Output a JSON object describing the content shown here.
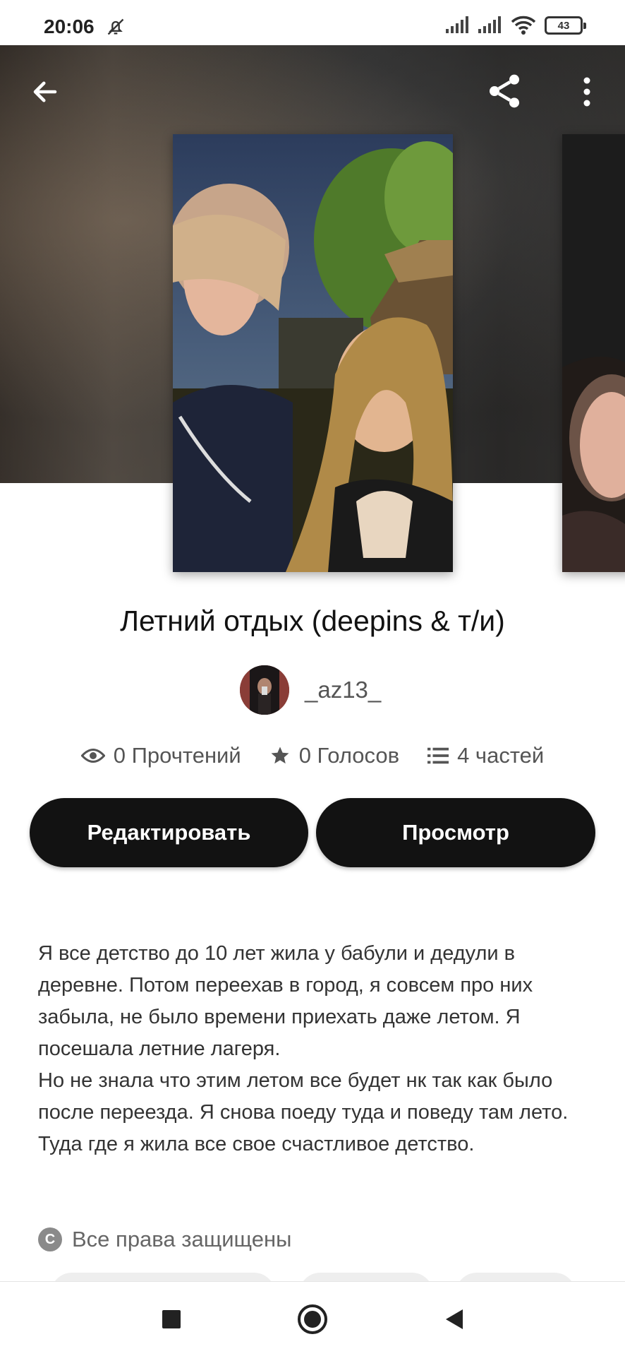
{
  "status_bar": {
    "time": "20:06",
    "battery": "43",
    "icons": [
      "bell-off-icon",
      "signal-icon",
      "signal-icon",
      "wifi-icon",
      "battery-icon"
    ]
  },
  "toolbar": {
    "back_icon": "arrow-left-icon",
    "share_icon": "share-icon",
    "more_icon": "more-vertical-icon"
  },
  "story": {
    "title": "Летний отдых (deepins & т/и)",
    "author": "_az13_",
    "stats": {
      "reads": "0 Прочтений",
      "votes": "0 Голосов",
      "parts": "4 частей"
    },
    "buttons": {
      "edit": "Редактировать",
      "view": "Просмотр"
    },
    "description": "Я все детство до 10 лет жила у бабули и дедули в деревне. Потом переехав в город, я совсем про них забыла, не было времени приехать даже летом. Я посешала летние лагеря.\nНо не знала что этим летом все будет нк так как было после переезда. Я снова поеду туда и поведу там лето. Туда где я жила все свое счастливое детство.",
    "copyright": "Все права защищены"
  },
  "colors": {
    "primary": "#121212",
    "background": "#ffffff",
    "muted": "#555555"
  }
}
